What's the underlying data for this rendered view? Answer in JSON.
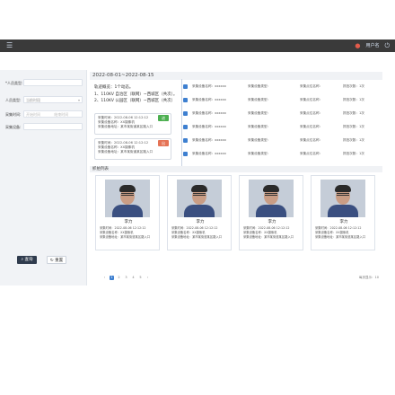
{
  "topbar": {
    "user": "用户名"
  },
  "filters": [
    {
      "label": "*人员类型:",
      "value": "",
      "type": "text"
    },
    {
      "label": "人员类型:",
      "value": "当前时段",
      "type": "select"
    },
    {
      "label": "采集时间:",
      "start": "开始时间",
      "end": "结束时间",
      "type": "date"
    },
    {
      "label": "采集设备:",
      "value": "",
      "type": "text"
    }
  ],
  "buttons": {
    "query": "查询",
    "reset": "重置"
  },
  "date_range": "2022-08-01~2022-08-15",
  "summary": [
    "轨迹概览：1个动态。",
    "1、110KV 自治区（联网）~西城区（共次）。",
    "2、110KV 公园区（联网）~西城区（共次）"
  ],
  "cards": [
    {
      "tag": "进",
      "tag_color": "#4caf50",
      "lines": [
        "采集时间：2022-08-06 12:12:12",
        "采集设备名称：XX摄像机",
        "采集设备地址：某市某街道某区路入口"
      ]
    },
    {
      "tag": "出",
      "tag_color": "#e57355",
      "lines": [
        "采集时间：2022-08-06 12:12:12",
        "采集设备名称：XX摄像机",
        "采集设备地址：某市某街道某区路入口"
      ]
    }
  ],
  "timeline": [
    {
      "device": "采集设备名称：xxxxxx",
      "type": "采集设备类型：",
      "location": "采集点位名称：",
      "count": "抓拍次数：1次"
    },
    {
      "device": "采集设备名称：xxxxxx",
      "type": "采集设备类型：",
      "location": "采集点位名称：",
      "count": "抓拍次数：1次"
    },
    {
      "device": "采集设备名称：xxxxxx",
      "type": "采集设备类型：",
      "location": "采集点位名称：",
      "count": "抓拍次数：1次"
    },
    {
      "device": "采集设备名称：xxxxxx",
      "type": "采集设备类型：",
      "location": "采集点位名称：",
      "count": "抓拍次数：1次"
    },
    {
      "device": "采集设备名称：xxxxxx",
      "type": "采集设备类型：",
      "location": "采集点位名称：",
      "count": "抓拍次数：1次"
    },
    {
      "device": "采集设备名称：xxxxxx",
      "type": "采集设备类型：",
      "location": "采集点位名称：",
      "count": "抓拍次数：1次"
    }
  ],
  "section_title": "抓拍列表",
  "people": [
    {
      "name": "李力",
      "time": "采集时间：2022-08-06 12:12:12",
      "device": "采集设备名称：XX摄像机",
      "address": "采集设备地址：某市某街道某区路入口"
    },
    {
      "name": "李力",
      "time": "采集时间：2022-08-06 12:12:12",
      "device": "采集设备名称：XX摄像机",
      "address": "采集设备地址：某市某街道某区路入口"
    },
    {
      "name": "李力",
      "time": "采集时间：2022-08-06 12:12:12",
      "device": "采集设备名称：XX摄像机",
      "address": "采集设备地址：某市某街道某区路入口"
    },
    {
      "name": "李力",
      "time": "采集时间：2022-08-06 12:12:12",
      "device": "采集设备名称：XX摄像机",
      "address": "采集设备地址：某市某街道某区路入口"
    }
  ],
  "pagination": {
    "pages": [
      "1",
      "2",
      "3",
      "4",
      "5"
    ],
    "active": "1",
    "size": "每页显示：10"
  },
  "colors": {
    "topbar": "#3a3a3a",
    "accent": "#3d7fd0",
    "tag_in": "#4caf50",
    "tag_out": "#e57355"
  },
  "icons": {
    "menu": "menu-icon",
    "user": "user-icon",
    "power": "power-icon"
  }
}
